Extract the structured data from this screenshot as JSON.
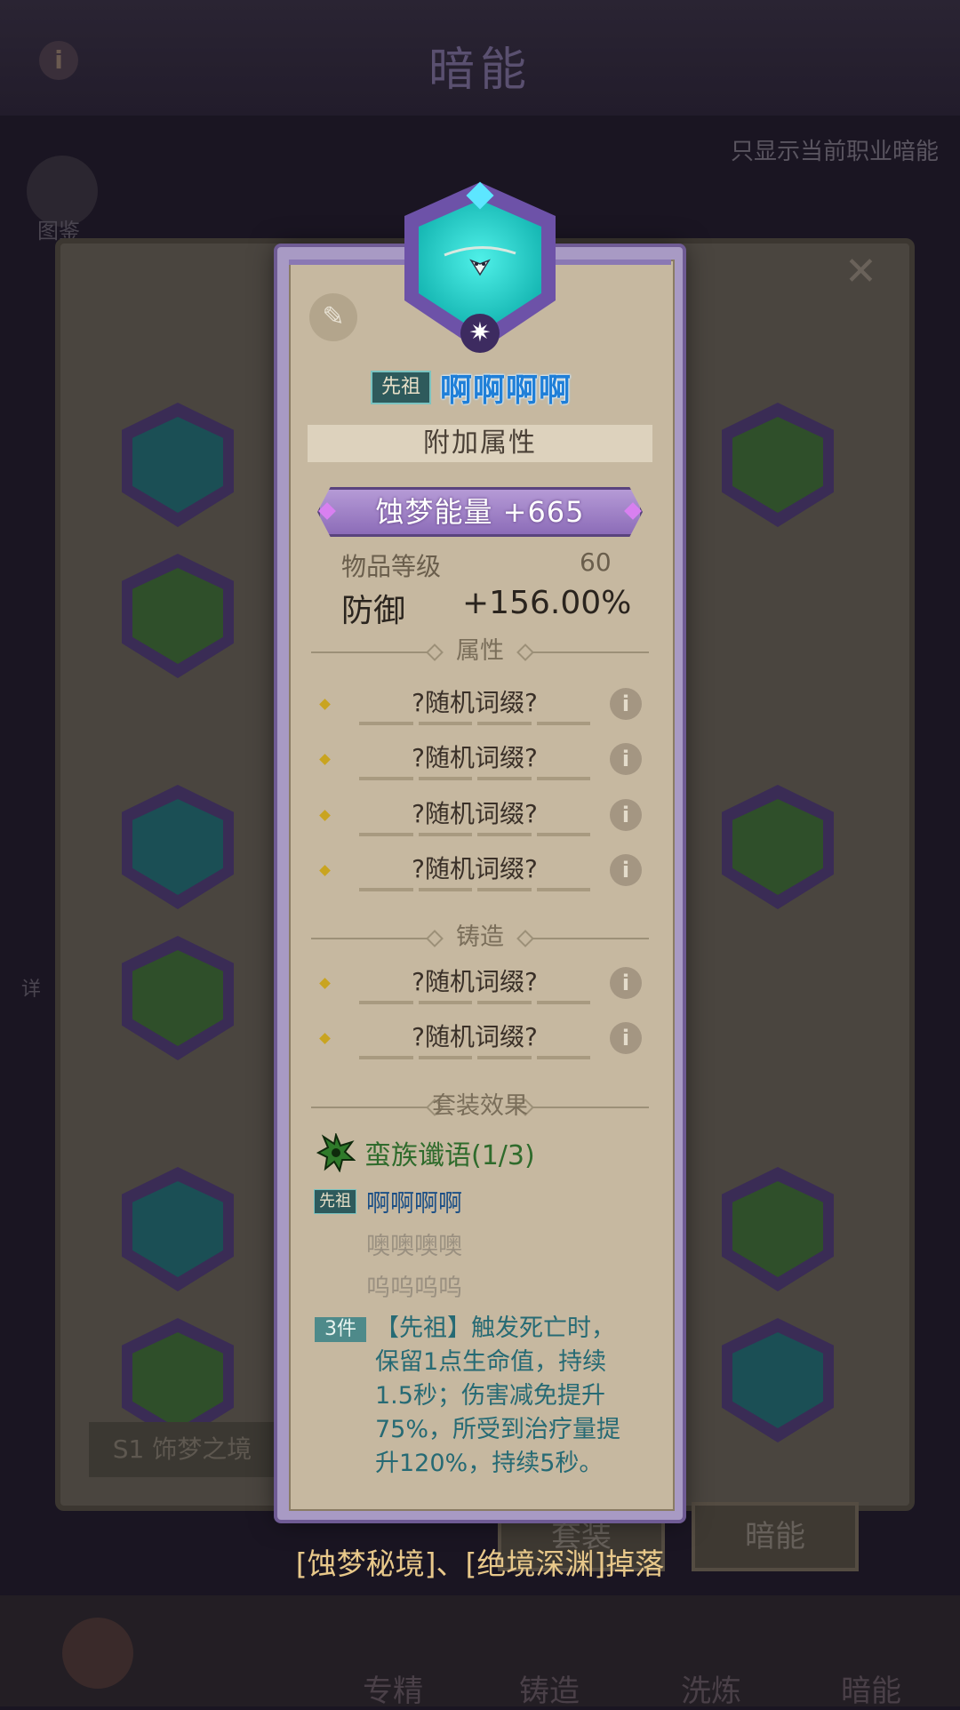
{
  "background": {
    "title": "暗能",
    "info_icon": "i",
    "filter_label": "只显示当前职业暗能",
    "book_label": "图鉴",
    "detail_label": "详",
    "close_icon": "✕",
    "season_label": "S1 饰梦之境",
    "button_set": "套装",
    "button_dark": "暗能",
    "nav_items": [
      "专精",
      "铸造",
      "洗炼",
      "暗能"
    ]
  },
  "tooltip": {
    "quality_tag": "先祖",
    "item_name": "啊啊啊啊",
    "extra_attr_header": "附加属性",
    "energy_text": "蚀梦能量  +665",
    "item_level_label": "物品等级",
    "item_level_value": "60",
    "defense_label": "防御",
    "defense_value": "+156.00%",
    "section_attributes": "属性",
    "attribute_affixes": [
      "?随机词缀?",
      "?随机词缀?",
      "?随机词缀?",
      "?随机词缀?"
    ],
    "section_forge": "铸造",
    "forge_affixes": [
      "?随机词缀?",
      "?随机词缀?"
    ],
    "section_set": "套装效果",
    "set_name": "蛮族谶语(1/3)",
    "set_piece_tag": "先祖",
    "set_pieces": [
      {
        "name": "啊啊啊啊",
        "owned": true
      },
      {
        "name": "噢噢噢噢",
        "owned": false
      },
      {
        "name": "呜呜呜呜",
        "owned": false
      }
    ],
    "set_bonus_count": "3件",
    "set_bonus_lines": [
      "【先祖】触发死亡时，",
      "保留1点生命值，持续",
      "1.5秒；伤害减免提升",
      "75%，所受到治疗量提",
      "升120%，持续5秒。"
    ],
    "info_icon": "i"
  },
  "drop_source": "[蚀梦秘境]、[绝境深渊]掉落",
  "colors": {
    "item_name": "#1f7fd8",
    "set_name": "#2f6b2c",
    "set_desc": "#266a74",
    "energy_banner": "#8c6cb8"
  }
}
